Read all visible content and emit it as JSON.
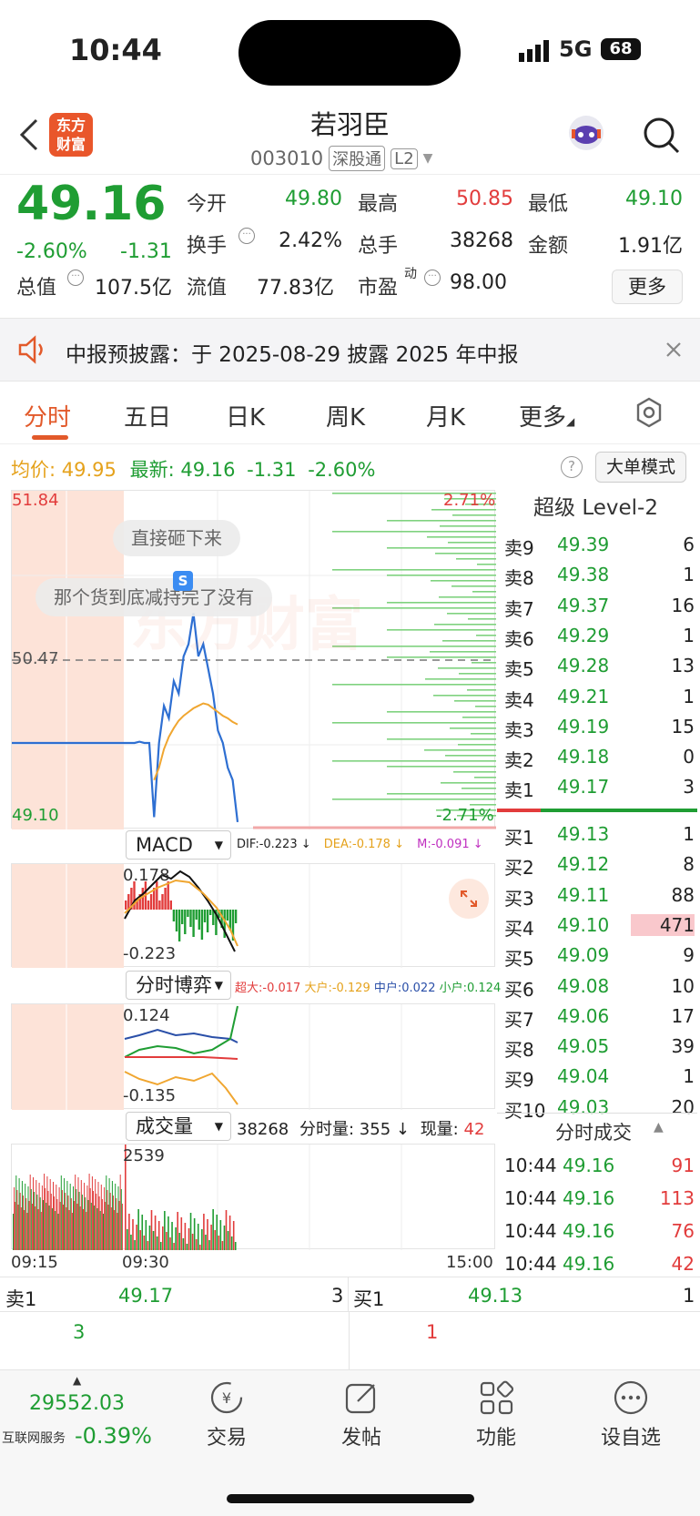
{
  "status": {
    "time": "10:44",
    "network": "5G",
    "battery": "68"
  },
  "header": {
    "title": "若羽臣",
    "code": "003010",
    "market_badge": "深股通",
    "level_badge": "L2",
    "logo_text_1": "东方",
    "logo_text_2": "财富"
  },
  "quote": {
    "price": "49.16",
    "change_pct": "-2.60%",
    "change": "-1.31",
    "fields": [
      {
        "label": "今开",
        "value": "49.80"
      },
      {
        "label": "最高",
        "value": "50.85"
      },
      {
        "label": "最低",
        "value": "49.10"
      },
      {
        "label": "换手",
        "value": "2.42%"
      },
      {
        "label": "总手",
        "value": "38268"
      },
      {
        "label": "金额",
        "value": "1.91亿"
      },
      {
        "label": "总值",
        "value": "107.5亿"
      },
      {
        "label": "流值",
        "value": "77.83亿"
      },
      {
        "label": "市盈",
        "sup": "动",
        "value": "98.00"
      }
    ],
    "more_button": "更多"
  },
  "notice": {
    "text": "中报预披露：于 2025-08-29 披露 2025 年中报"
  },
  "tabs": [
    "分时",
    "五日",
    "日K",
    "周K",
    "月K",
    "更多"
  ],
  "chart_info": {
    "avg_label": "均价:",
    "avg_value": "49.95",
    "latest_label": "最新:",
    "latest_value": "49.16",
    "latest_change": "-1.31",
    "latest_pct": "-2.60%",
    "mode_button": "大单模式"
  },
  "chart_data": {
    "type": "line",
    "x_ticks": [
      "09:15",
      "09:30",
      "15:00"
    ],
    "y_max": "51.84",
    "y_mid": "50.47",
    "y_min": "49.10",
    "pct_max": "2.71%",
    "pct_min": "-2.71%",
    "series": [
      {
        "values": [
          49.8,
          49.8,
          49.8,
          49.81,
          49.8,
          49.8,
          49.2,
          49.8,
          50.1,
          50.0,
          50.3,
          50.2,
          50.5,
          50.6,
          50.85,
          50.5,
          50.6,
          50.4,
          50.2,
          49.9,
          49.8,
          49.6,
          49.5,
          49.16
        ]
      },
      {
        "values": [
          49.8,
          49.8,
          49.8,
          49.8,
          49.8,
          49.8,
          49.5,
          49.6,
          49.75,
          49.85,
          49.92,
          49.98,
          50.02,
          50.05,
          50.08,
          50.1,
          50.12,
          50.11,
          50.08,
          50.05,
          50.02,
          50.0,
          49.97,
          49.95
        ]
      }
    ]
  },
  "comments": [
    "直接砸下来",
    "那个货到底减持完了没有"
  ],
  "watermark": "东方财富",
  "macd": {
    "selector": "MACD",
    "dif": "DIF:-0.223 ↓",
    "dea": "DEA:-0.178 ↓",
    "m": "M:-0.091 ↓",
    "top": "0.178",
    "bottom": "-0.223"
  },
  "game": {
    "selector": "分时博弈",
    "super": "超大:-0.017",
    "big": "大户:-0.129",
    "mid": "中户:0.022",
    "small": "小户:0.124",
    "top": "0.124",
    "bottom": "-0.135"
  },
  "volume": {
    "selector": "成交量",
    "total": "38268",
    "minute": "分时量: 355 ↓",
    "now_label": "现量:",
    "now": "42",
    "peak": "2539"
  },
  "level2": {
    "title": "超级 Level-2",
    "sells": [
      {
        "label": "卖9",
        "price": "49.39",
        "qty": "6"
      },
      {
        "label": "卖8",
        "price": "49.38",
        "qty": "1"
      },
      {
        "label": "卖7",
        "price": "49.37",
        "qty": "16"
      },
      {
        "label": "卖6",
        "price": "49.29",
        "qty": "1"
      },
      {
        "label": "卖5",
        "price": "49.28",
        "qty": "13"
      },
      {
        "label": "卖4",
        "price": "49.21",
        "qty": "1"
      },
      {
        "label": "卖3",
        "price": "49.19",
        "qty": "15"
      },
      {
        "label": "卖2",
        "price": "49.18",
        "qty": "0"
      },
      {
        "label": "卖1",
        "price": "49.17",
        "qty": "3"
      }
    ],
    "buys": [
      {
        "label": "买1",
        "price": "49.13",
        "qty": "1"
      },
      {
        "label": "买2",
        "price": "49.12",
        "qty": "8"
      },
      {
        "label": "买3",
        "price": "49.11",
        "qty": "88"
      },
      {
        "label": "买4",
        "price": "49.10",
        "qty": "471"
      },
      {
        "label": "买5",
        "price": "49.09",
        "qty": "9"
      },
      {
        "label": "买6",
        "price": "49.08",
        "qty": "10"
      },
      {
        "label": "买7",
        "price": "49.06",
        "qty": "17"
      },
      {
        "label": "买8",
        "price": "49.05",
        "qty": "39"
      },
      {
        "label": "买9",
        "price": "49.04",
        "qty": "1"
      },
      {
        "label": "买10",
        "price": "49.03",
        "qty": "20"
      }
    ],
    "trades_title": "分时成交",
    "trades": [
      {
        "time": "10:44",
        "price": "49.16",
        "qty": "91"
      },
      {
        "time": "10:44",
        "price": "49.16",
        "qty": "113"
      },
      {
        "time": "10:44",
        "price": "49.16",
        "qty": "76"
      },
      {
        "time": "10:44",
        "price": "49.16",
        "qty": "42"
      }
    ]
  },
  "summary": {
    "sell_label": "卖1",
    "sell_price": "49.17",
    "sell_qty": "3",
    "buy_label": "买1",
    "buy_price": "49.13",
    "buy_qty": "1",
    "sell_count": "3",
    "buy_count": "1"
  },
  "bottom": {
    "index_value": "29552.03",
    "index_name": "互联网服务",
    "index_change": "-0.39%",
    "nav": [
      "交易",
      "发帖",
      "功能",
      "设自选"
    ]
  }
}
